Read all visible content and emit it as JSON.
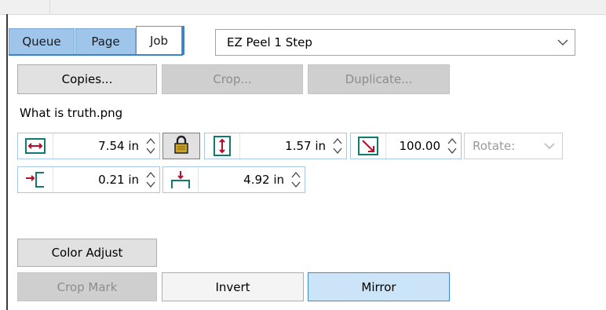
{
  "tabs": [
    {
      "label": "Queue",
      "active": false
    },
    {
      "label": "Page",
      "active": false
    },
    {
      "label": "Job",
      "active": true
    }
  ],
  "profile": {
    "selected": "EZ Peel 1 Step"
  },
  "buttons_top": {
    "copies": "Copies...",
    "crop": "Crop...",
    "duplicate": "Duplicate..."
  },
  "file": {
    "name": "What is truth.png"
  },
  "dims": {
    "width": "7.54 in",
    "height": "1.57 in",
    "scale": "100.00",
    "left": "0.21 in",
    "top": "4.92 in"
  },
  "rotate": {
    "label": "Rotate:"
  },
  "buttons_bottom": {
    "color_adjust": "Color Adjust",
    "crop_mark": "Crop Mark",
    "invert": "Invert",
    "mirror": "Mirror"
  },
  "colors": {
    "accent": "#3e82c6",
    "tab_inactive": "#9fc6ea",
    "icon_red": "#b0102a",
    "icon_teal": "#0f7a6e",
    "selected_button": "#cce4f7"
  }
}
